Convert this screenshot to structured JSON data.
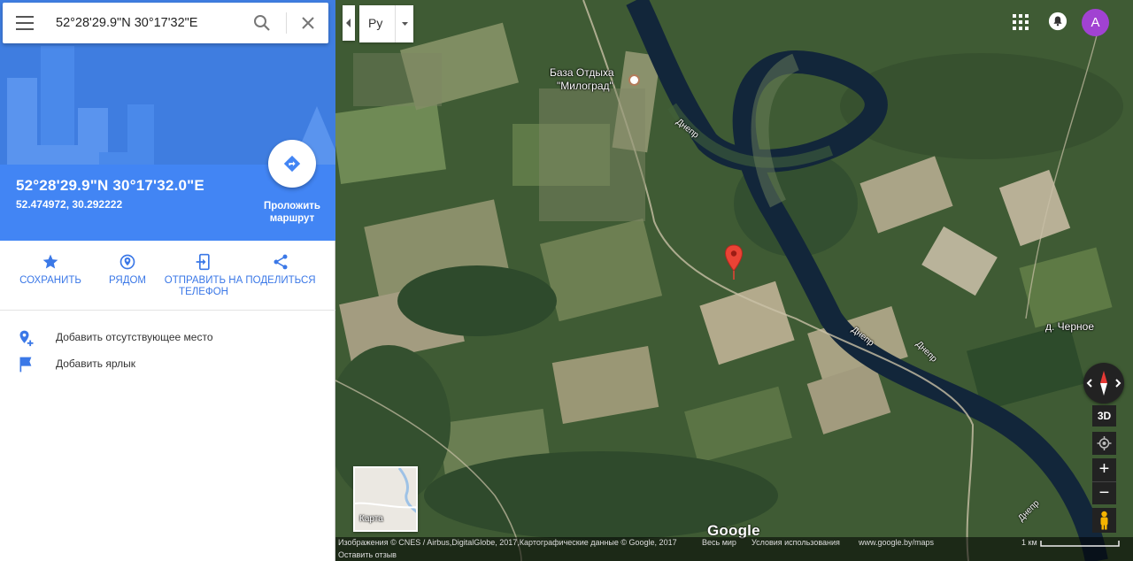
{
  "search": {
    "value": "52°28'29.9\"N 30°17'32\"E"
  },
  "place": {
    "title": "52°28'29.9\"N 30°17'32.0\"E",
    "decimal": "52.474972, 30.292222",
    "route_label": "Проложить маршрут"
  },
  "actions": [
    {
      "label": "СОХРАНИТЬ",
      "icon": "star-icon"
    },
    {
      "label": "РЯДОМ",
      "icon": "nearby-pin-icon"
    },
    {
      "label": "ОТПРАВИТЬ НА ТЕЛЕФОН",
      "icon": "send-to-phone-icon"
    },
    {
      "label": "ПОДЕЛИТЬСЯ",
      "icon": "share-icon"
    }
  ],
  "extras": [
    {
      "label": "Добавить отсутствующее место",
      "icon": "add-place-icon"
    },
    {
      "label": "Добавить ярлык",
      "icon": "flag-icon"
    }
  ],
  "map": {
    "language": "Ру",
    "avatar_letter": "A",
    "labels": {
      "poi_line1": "База Отдыха",
      "poi_line2": "\"Милоград\"",
      "village": "д. Черное",
      "river1": "Днепр",
      "river2": "Днепр",
      "river3": "Днепр",
      "river4": "Днепр"
    },
    "controls": {
      "three_d": "3D",
      "zoom_in": "+",
      "zoom_out": "−"
    },
    "minimap_label": "Карта",
    "logo": "Google",
    "footer": {
      "imagery": "Изображения © CNES / Airbus,DigitalGlobe, 2017,Картографические данные © Google, 2017",
      "region": "Весь мир",
      "terms": "Условия использования",
      "site": "www.google.by/maps",
      "scale": "1 км"
    },
    "feedback": "Оставить отзыв"
  },
  "colors": {
    "accent": "#4285f4",
    "link": "#3b78e7",
    "pin": "#ea4335",
    "avatar": "#a142d2"
  }
}
